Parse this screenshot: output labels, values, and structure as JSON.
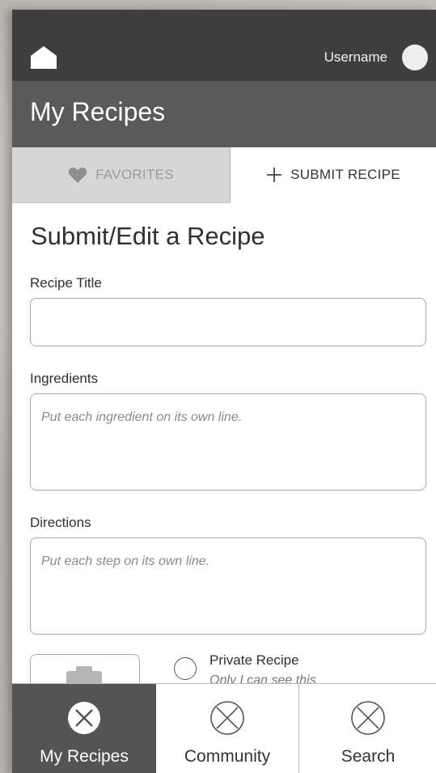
{
  "header": {
    "username": "Username"
  },
  "title_bar": {
    "title": "My Recipes"
  },
  "tabs": [
    {
      "label": "FAVORITES",
      "icon": "heart-icon"
    },
    {
      "label": "SUBMIT RECIPE",
      "icon": "plus-icon"
    }
  ],
  "form": {
    "title": "Submit/Edit a Recipe",
    "recipe_title_label": "Recipe Title",
    "recipe_title_value": "",
    "ingredients_label": "Ingredients",
    "ingredients_placeholder": "Put each ingredient on its own line.",
    "directions_label": "Directions",
    "directions_placeholder": "Put each step on its own line.",
    "private_label": "Private Recipe",
    "private_sub": "Only I can see this"
  },
  "bottom_nav": [
    {
      "label": "My Recipes"
    },
    {
      "label": "Community"
    },
    {
      "label": "Search"
    }
  ],
  "colors": {
    "top_bar": "#3e3e3e",
    "title_bar": "#5a5a5a",
    "active_nav": "#545454",
    "inactive_tab": "#d6d6d6"
  }
}
